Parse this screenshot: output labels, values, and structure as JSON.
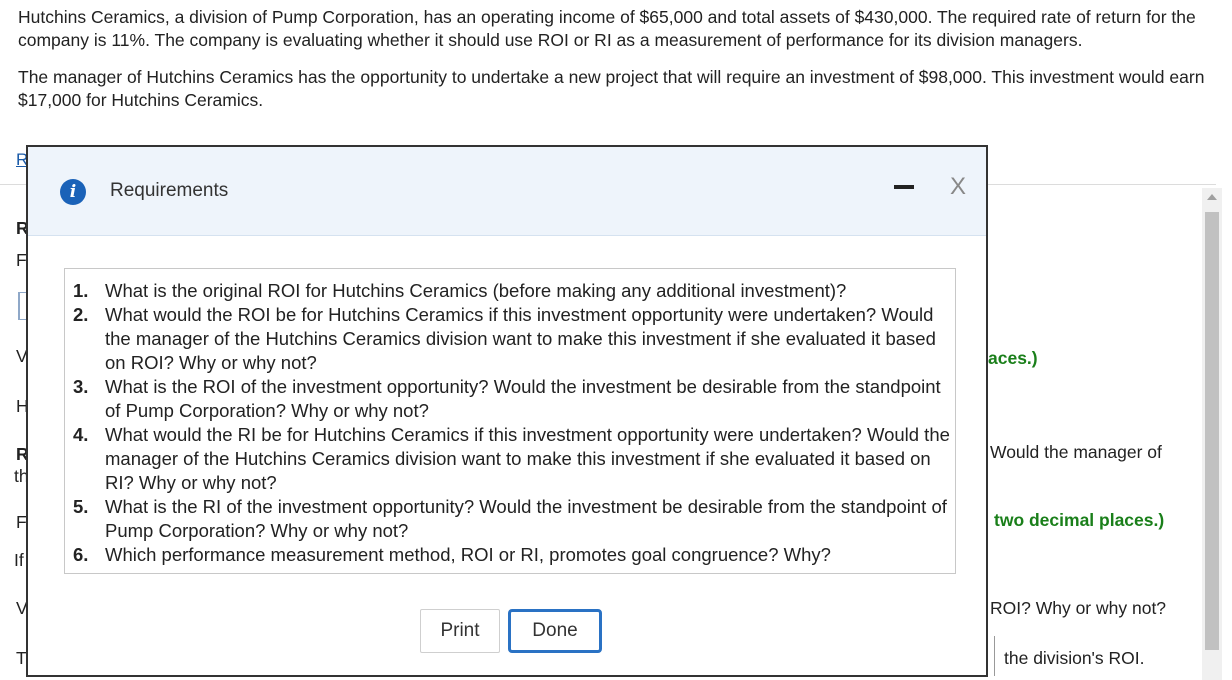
{
  "problem": {
    "para1": "Hutchins Ceramics, a division of Pump Corporation, has an operating income of $65,000 and total assets of $430,000. The required rate of return for the company is 11%. The company is evaluating whether it should use ROI or RI as a measurement of performance for its division managers.",
    "para2": "The manager of Hutchins Ceramics has the opportunity to undertake a new project that will require an investment of $98,000. This investment would earn $17,000 for Hutchins Ceramics."
  },
  "background": {
    "link_fragment": "R",
    "left_fragments": [
      "R",
      "F",
      "V",
      "H",
      "R",
      "th",
      "F",
      "If",
      "V",
      "T"
    ],
    "right_fragments": {
      "places_suffix": "aces.)",
      "would_manager": "Would the manager of",
      "two_decimal": "two decimal places.)",
      "roi_why": "ROI? Why or why not?",
      "division_roi": "the division's ROI."
    }
  },
  "modal": {
    "title": "Requirements",
    "info_icon_glyph": "i",
    "close_glyph": "X",
    "requirements": [
      {
        "num": "1.",
        "text": "What is the original ROI for Hutchins Ceramics (before making any additional investment)?"
      },
      {
        "num": "2.",
        "text": "What would the ROI be for Hutchins Ceramics if this investment opportunity were undertaken? Would the manager of the Hutchins Ceramics division want to make this investment if she evaluated it based on ROI? Why or why not?"
      },
      {
        "num": "3.",
        "text": "What is the ROI of the investment opportunity? Would the investment be desirable from the standpoint of Pump Corporation? Why or why not?"
      },
      {
        "num": "4.",
        "text": "What would the RI be for Hutchins Ceramics if this investment opportunity were undertaken? Would the manager of the Hutchins Ceramics division want to make this investment if she evaluated it based on RI? Why or why not?"
      },
      {
        "num": "5.",
        "text": "What is the RI of the investment opportunity? Would the investment be desirable from the standpoint of Pump Corporation? Why or why not?"
      },
      {
        "num": "6.",
        "text": "Which performance measurement method, ROI or RI, promotes goal congruence? Why?"
      }
    ],
    "print_label": "Print",
    "done_label": "Done"
  },
  "colors": {
    "accent": "#2a72c4",
    "info_icon": "#1a62b8",
    "header_bg": "#eef4fb",
    "green_text": "#1a7f1a"
  }
}
